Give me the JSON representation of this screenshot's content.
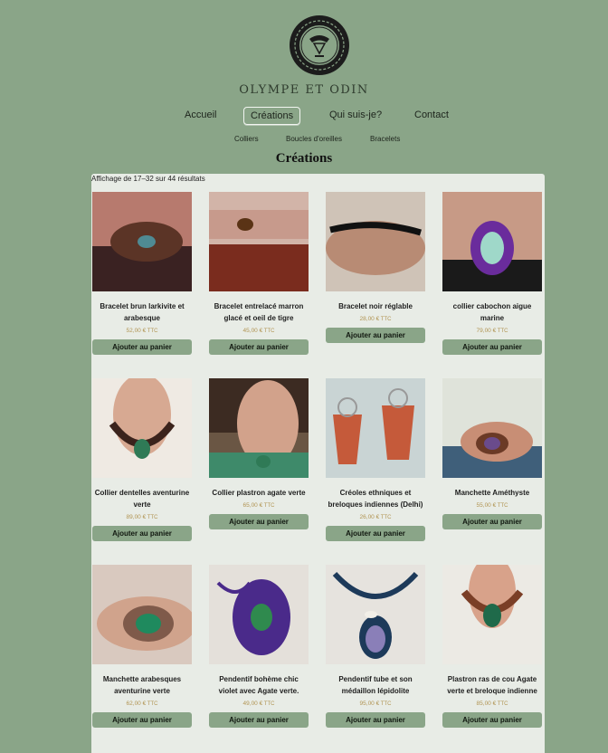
{
  "brand": {
    "name": "OLYMPE ET ODIN"
  },
  "nav": {
    "items": [
      {
        "label": "Accueil"
      },
      {
        "label": "Créations"
      },
      {
        "label": "Qui suis-je?"
      },
      {
        "label": "Contact"
      }
    ],
    "active": "Créations"
  },
  "subnav": {
    "items": [
      {
        "label": "Colliers"
      },
      {
        "label": "Boucles d'oreilles"
      },
      {
        "label": "Bracelets"
      }
    ]
  },
  "page": {
    "title": "Créations",
    "result_count": "Affichage de 17–32 sur 44 résultats"
  },
  "products": [
    {
      "name": "Bracelet brun larkivite et arabesque",
      "price": "52,00 €",
      "tax": "TTC",
      "button": "Ajouter au panier"
    },
    {
      "name": "Bracelet entrelacé marron glacé et oeil de tigre",
      "price": "45,00 €",
      "tax": "TTC",
      "button": "Ajouter au panier"
    },
    {
      "name": "Bracelet noir réglable",
      "price": "28,00 €",
      "tax": "TTC",
      "button": "Ajouter au panier"
    },
    {
      "name": "collier cabochon aigue marine",
      "price": "79,00 €",
      "tax": "TTC",
      "button": "Ajouter au panier"
    },
    {
      "name": "Collier dentelles aventurine verte",
      "price": "89,00 €",
      "tax": "TTC",
      "button": "Ajouter au panier"
    },
    {
      "name": "Collier plastron agate verte",
      "price": "65,00 €",
      "tax": "TTC",
      "button": "Ajouter au panier"
    },
    {
      "name": "Créoles ethniques et breloques indiennes (Delhi)",
      "price": "26,00 €",
      "tax": "TTC",
      "button": "Ajouter au panier"
    },
    {
      "name": "Manchette Améthyste",
      "price": "55,00 €",
      "tax": "TTC",
      "button": "Ajouter au panier"
    },
    {
      "name": "Manchette arabesques aventurine verte",
      "price": "62,00 €",
      "tax": "TTC",
      "button": "Ajouter au panier"
    },
    {
      "name": "Pendentif bohème chic violet avec Agate verte.",
      "price": "49,00 €",
      "tax": "TTC",
      "button": "Ajouter au panier"
    },
    {
      "name": "Pendentif tube et son médaillon lépidolite",
      "price": "95,00 €",
      "tax": "TTC",
      "button": "Ajouter au panier"
    },
    {
      "name": "Plastron ras de cou Agate verte et breloque indienne",
      "price": "85,00 €",
      "tax": "TTC",
      "button": "Ajouter au panier"
    }
  ],
  "colors": {
    "background": "#8aa588",
    "panel": "#e8ece6",
    "button": "#8aa588",
    "price": "#b19452"
  }
}
